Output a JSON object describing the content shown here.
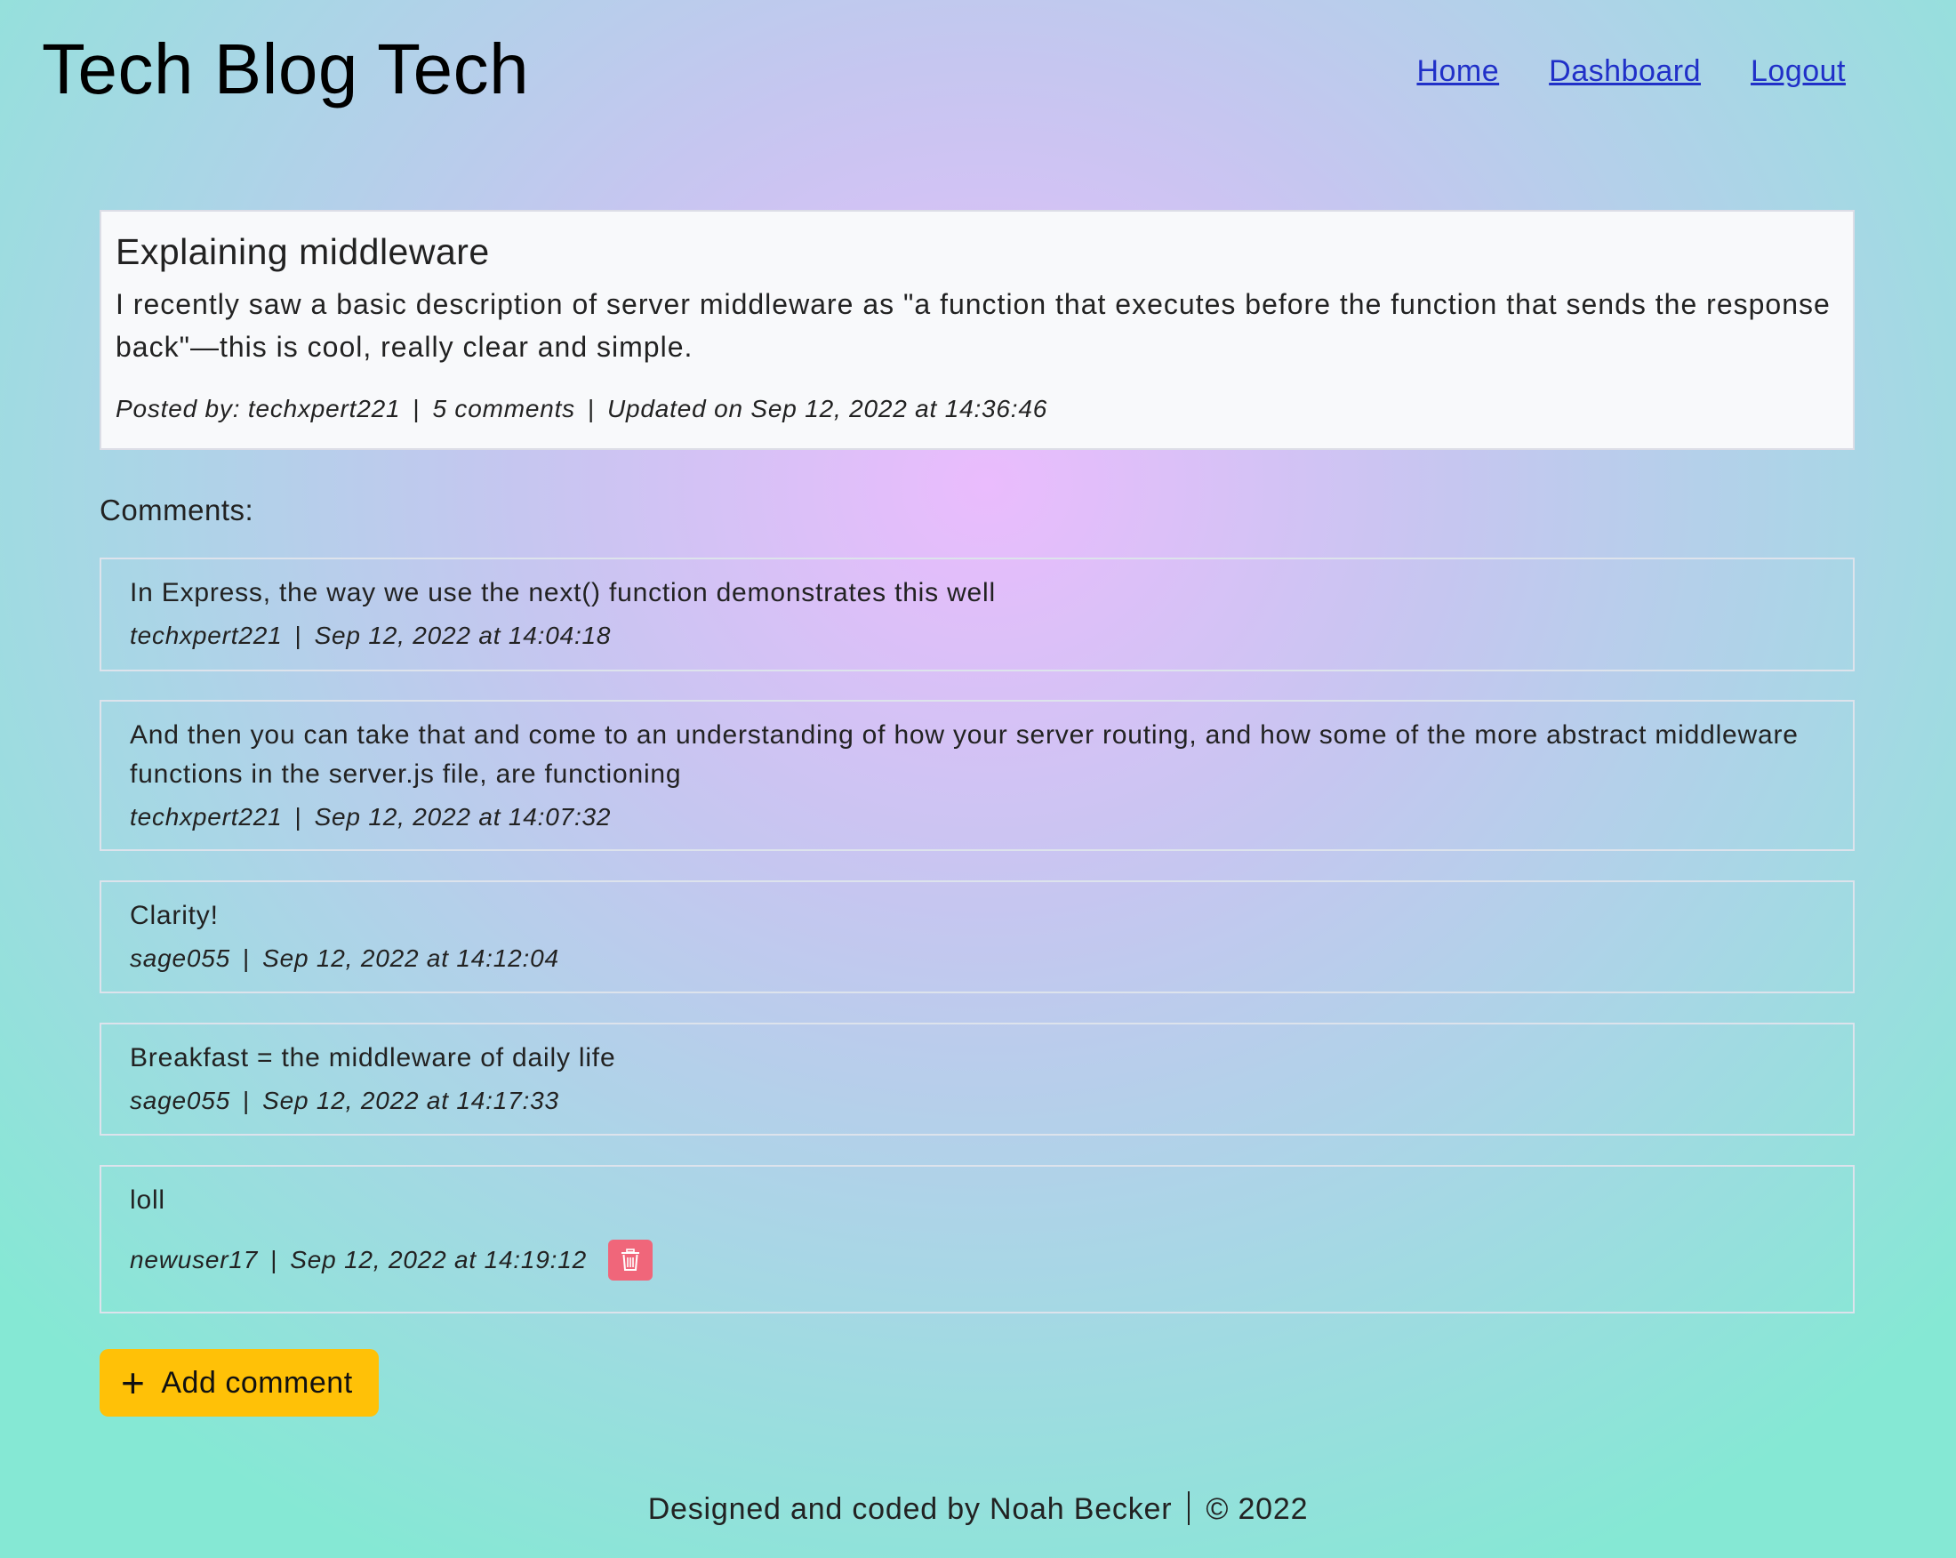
{
  "header": {
    "title": "Tech Blog Tech",
    "nav": {
      "home": "Home",
      "dashboard": "Dashboard",
      "logout": "Logout"
    }
  },
  "post": {
    "title": "Explaining middleware",
    "body": "I recently saw a basic description of server middleware as \"a function that executes before the function that sends the response back\"—this is cool, really clear and simple.",
    "author": "Posted by: techxpert221",
    "comment_count": "5 comments",
    "updated": "Updated on Sep 12, 2022 at 14:36:46"
  },
  "comments_label": "Comments:",
  "comments": [
    {
      "text": "In Express, the way we use the next() function demonstrates this well",
      "author": "techxpert221",
      "date": "Sep 12, 2022 at 14:04:18"
    },
    {
      "text": "And then you can take that and come to an understanding of how your server routing, and how some of the more abstract middleware functions in the server.js file, are functioning",
      "author": "techxpert221",
      "date": "Sep 12, 2022 at 14:07:32"
    },
    {
      "text": "Clarity!",
      "author": "sage055",
      "date": "Sep 12, 2022 at 14:12:04"
    },
    {
      "text": "Breakfast = the middleware of daily life",
      "author": "sage055",
      "date": "Sep 12, 2022 at 14:17:33"
    },
    {
      "text": "loll",
      "author": "newuser17",
      "date": "Sep 12, 2022 at 14:19:12",
      "delete_icon": "trash-icon"
    }
  ],
  "add_comment_label": "Add comment",
  "footer": {
    "credit": "Designed and coded by Noah Becker",
    "copyright": "© 2022"
  },
  "colors": {
    "link": "#2030c8",
    "add_button": "#ffc107",
    "delete_button": "#f0667a"
  }
}
